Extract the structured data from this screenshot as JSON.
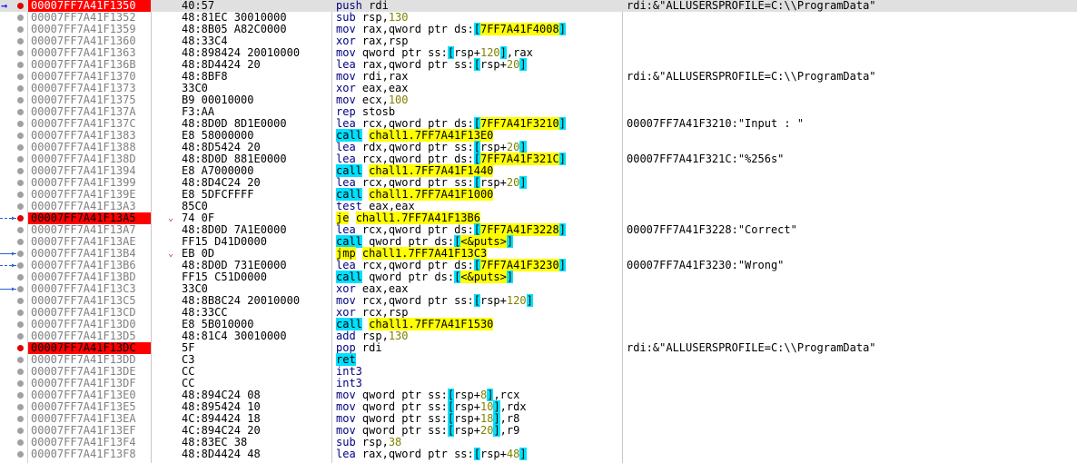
{
  "rows": [
    {
      "addr": "00007FF7A41F1350",
      "bytes": "40:57",
      "instr": "push rdi",
      "comment": "rdi:&\"ALLUSERSPROFILE=C:\\\\ProgramData\""
    },
    {
      "addr": "00007FF7A41F1352",
      "bytes": "48:81EC 30010000",
      "instr": "sub rsp,130",
      "comment": ""
    },
    {
      "addr": "00007FF7A41F1359",
      "bytes": "48:8B05 A82C0000",
      "instr": "mov rax,qword ptr ds:[7FF7A41F4008]",
      "comment": ""
    },
    {
      "addr": "00007FF7A41F1360",
      "bytes": "48:33C4",
      "instr": "xor rax,rsp",
      "comment": ""
    },
    {
      "addr": "00007FF7A41F1363",
      "bytes": "48:898424 20010000",
      "instr": "mov qword ptr ss:[rsp+120],rax",
      "comment": ""
    },
    {
      "addr": "00007FF7A41F136B",
      "bytes": "48:8D4424 20",
      "instr": "lea rax,qword ptr ss:[rsp+20]",
      "comment": ""
    },
    {
      "addr": "00007FF7A41F1370",
      "bytes": "48:8BF8",
      "instr": "mov rdi,rax",
      "comment": "rdi:&\"ALLUSERSPROFILE=C:\\\\ProgramData\""
    },
    {
      "addr": "00007FF7A41F1373",
      "bytes": "33C0",
      "instr": "xor eax,eax",
      "comment": ""
    },
    {
      "addr": "00007FF7A41F1375",
      "bytes": "B9 00010000",
      "instr": "mov ecx,100",
      "comment": ""
    },
    {
      "addr": "00007FF7A41F137A",
      "bytes": "F3:AA",
      "instr": "rep stosb",
      "comment": ""
    },
    {
      "addr": "00007FF7A41F137C",
      "bytes": "48:8D0D 8D1E0000",
      "instr": "lea rcx,qword ptr ds:[7FF7A41F3210]",
      "comment": "00007FF7A41F3210:\"Input : \""
    },
    {
      "addr": "00007FF7A41F1383",
      "bytes": "E8 58000000",
      "instr": "call chall1.7FF7A41F13E0",
      "comment": ""
    },
    {
      "addr": "00007FF7A41F1388",
      "bytes": "48:8D5424 20",
      "instr": "lea rdx,qword ptr ss:[rsp+20]",
      "comment": ""
    },
    {
      "addr": "00007FF7A41F138D",
      "bytes": "48:8D0D 881E0000",
      "instr": "lea rcx,qword ptr ds:[7FF7A41F321C]",
      "comment": "00007FF7A41F321C:\"%256s\""
    },
    {
      "addr": "00007FF7A41F1394",
      "bytes": "E8 A7000000",
      "instr": "call chall1.7FF7A41F1440",
      "comment": ""
    },
    {
      "addr": "00007FF7A41F1399",
      "bytes": "48:8D4C24 20",
      "instr": "lea rcx,qword ptr ss:[rsp+20]",
      "comment": ""
    },
    {
      "addr": "00007FF7A41F139E",
      "bytes": "E8 5DFCFFFF",
      "instr": "call chall1.7FF7A41F1000",
      "comment": ""
    },
    {
      "addr": "00007FF7A41F13A3",
      "bytes": "85C0",
      "instr": "test eax,eax",
      "comment": ""
    },
    {
      "addr": "00007FF7A41F13A5",
      "bytes": "74 0F",
      "instr": "je chall1.7FF7A41F13B6",
      "comment": ""
    },
    {
      "addr": "00007FF7A41F13A7",
      "bytes": "48:8D0D 7A1E0000",
      "instr": "lea rcx,qword ptr ds:[7FF7A41F3228]",
      "comment": "00007FF7A41F3228:\"Correct\""
    },
    {
      "addr": "00007FF7A41F13AE",
      "bytes": "FF15 D41D0000",
      "instr": "call qword ptr ds:[<&puts>]",
      "comment": ""
    },
    {
      "addr": "00007FF7A41F13B4",
      "bytes": "EB 0D",
      "instr": "jmp chall1.7FF7A41F13C3",
      "comment": ""
    },
    {
      "addr": "00007FF7A41F13B6",
      "bytes": "48:8D0D 731E0000",
      "instr": "lea rcx,qword ptr ds:[7FF7A41F3230]",
      "comment": "00007FF7A41F3230:\"Wrong\""
    },
    {
      "addr": "00007FF7A41F13BD",
      "bytes": "FF15 C51D0000",
      "instr": "call qword ptr ds:[<&puts>]",
      "comment": ""
    },
    {
      "addr": "00007FF7A41F13C3",
      "bytes": "33C0",
      "instr": "xor eax,eax",
      "comment": ""
    },
    {
      "addr": "00007FF7A41F13C5",
      "bytes": "48:8B8C24 20010000",
      "instr": "mov rcx,qword ptr ss:[rsp+120]",
      "comment": ""
    },
    {
      "addr": "00007FF7A41F13CD",
      "bytes": "48:33CC",
      "instr": "xor rcx,rsp",
      "comment": ""
    },
    {
      "addr": "00007FF7A41F13D0",
      "bytes": "E8 5B010000",
      "instr": "call chall1.7FF7A41F1530",
      "comment": ""
    },
    {
      "addr": "00007FF7A41F13D5",
      "bytes": "48:81C4 30010000",
      "instr": "add rsp,130",
      "comment": ""
    },
    {
      "addr": "00007FF7A41F13DC",
      "bytes": "5F",
      "instr": "pop rdi",
      "comment": "rdi:&\"ALLUSERSPROFILE=C:\\\\ProgramData\""
    },
    {
      "addr": "00007FF7A41F13DD",
      "bytes": "C3",
      "instr": "ret",
      "comment": ""
    },
    {
      "addr": "00007FF7A41F13DE",
      "bytes": "CC",
      "instr": "int3",
      "comment": ""
    },
    {
      "addr": "00007FF7A41F13DF",
      "bytes": "CC",
      "instr": "int3",
      "comment": ""
    },
    {
      "addr": "00007FF7A41F13E0",
      "bytes": "48:894C24 08",
      "instr": "mov qword ptr ss:[rsp+8],rcx",
      "comment": ""
    },
    {
      "addr": "00007FF7A41F13E5",
      "bytes": "48:895424 10",
      "instr": "mov qword ptr ss:[rsp+10],rdx",
      "comment": ""
    },
    {
      "addr": "00007FF7A41F13EA",
      "bytes": "4C:894424 18",
      "instr": "mov qword ptr ss:[rsp+18],r8",
      "comment": ""
    },
    {
      "addr": "00007FF7A41F13EF",
      "bytes": "4C:894C24 20",
      "instr": "mov qword ptr ss:[rsp+20],r9",
      "comment": ""
    },
    {
      "addr": "00007FF7A41F13F4",
      "bytes": "48:83EC 38",
      "instr": "sub rsp,38",
      "comment": ""
    },
    {
      "addr": "00007FF7A41F13F8",
      "bytes": "48:8D4424 48",
      "instr": "lea rax,qword ptr ss:[rsp+48]",
      "comment": ""
    }
  ],
  "breakpoints": [
    "00007FF7A41F1350",
    "00007FF7A41F13A5",
    "00007FF7A41F13DC"
  ],
  "current_ip": "00007FF7A41F1350",
  "icons": {
    "instruction_pointer": "ip-arrow-icon",
    "breakpoint": "breakpoint-dot-icon",
    "jump_target": "jump-arrow-icon"
  },
  "colors": {
    "breakpoint_bg": "#ff0000",
    "call_highlight": "#00e0ff",
    "target_highlight": "#ffff00",
    "mnemonic": "#000080",
    "number": "#808000"
  }
}
